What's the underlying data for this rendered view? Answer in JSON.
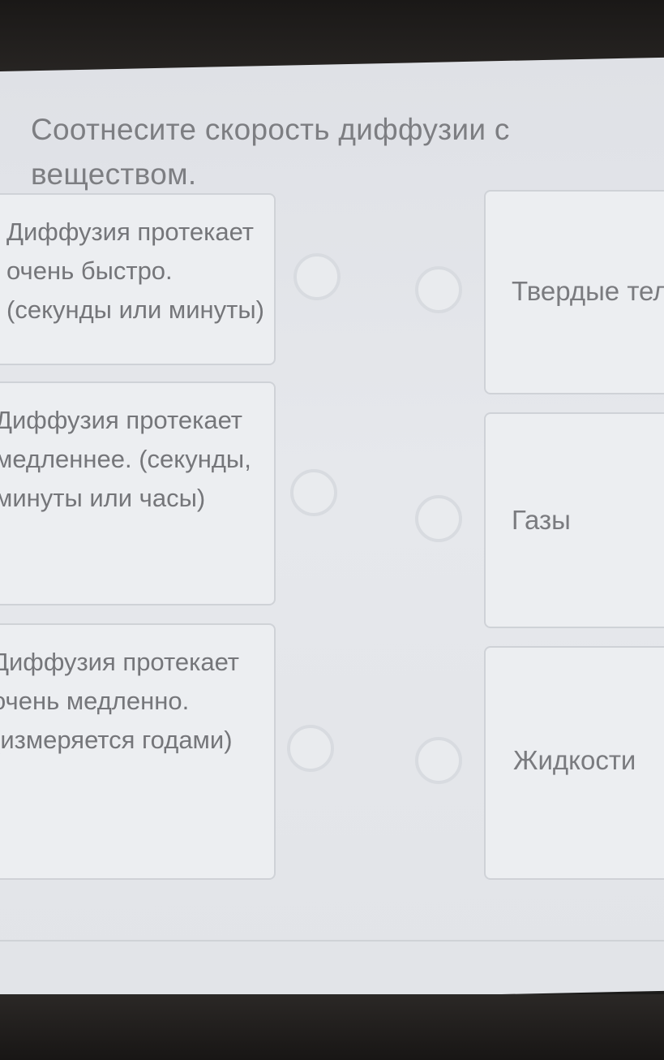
{
  "question": {
    "title": "Соотнесите скорость диффузии с веществом."
  },
  "left_items": [
    {
      "text": "Диффузия протекает очень быстро. (секунды или минуты)"
    },
    {
      "text": "Диффузия протекает медленнее. (секунды, минуты или часы)"
    },
    {
      "text": "Диффузия протекает очень медленно. (измеряется годами)"
    }
  ],
  "right_items": [
    {
      "text": "Твердые тела"
    },
    {
      "text": "Газы"
    },
    {
      "text": "Жидкости"
    }
  ]
}
